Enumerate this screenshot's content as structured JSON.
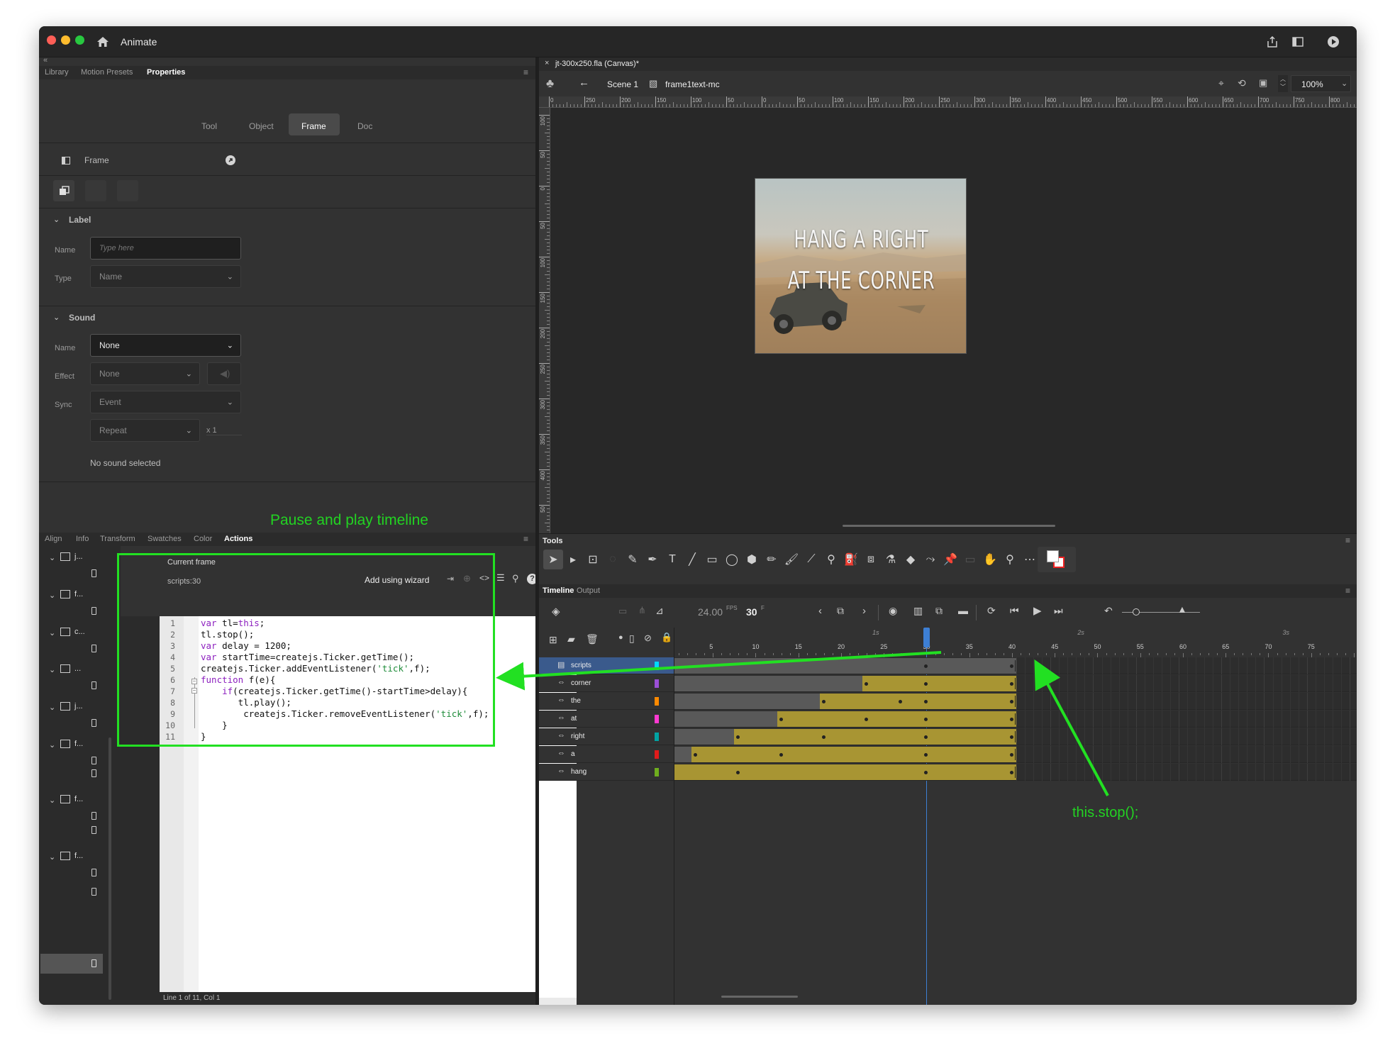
{
  "app": {
    "name": "Animate",
    "document_tab": "jt-300x250.fla (Canvas)*"
  },
  "colors": {
    "annotation_green": "#22e022",
    "tween_gold": "#a89533",
    "playhead_blue": "#3d7fd4",
    "selected_layer": "#3a5a8c"
  },
  "left_panel": {
    "collapse_glyph": "«",
    "tabs": [
      "Library",
      "Motion Presets",
      "Properties"
    ],
    "active_tab": "Properties",
    "prop_tabs": [
      "Tool",
      "Object",
      "Frame",
      "Doc"
    ],
    "active_prop_tab": "Frame",
    "frame_header": "Frame",
    "label_section": {
      "title": "Label",
      "name_label": "Name",
      "name_placeholder": "Type here",
      "type_label": "Type",
      "type_value": "Name"
    },
    "sound_section": {
      "title": "Sound",
      "name_label": "Name",
      "name_value": "None",
      "effect_label": "Effect",
      "effect_value": "None",
      "sync_label": "Sync",
      "sync_value": "Event",
      "repeat_value": "Repeat",
      "repeat_count": "x 1",
      "status": "No sound selected"
    }
  },
  "actions_panel": {
    "tabs": [
      "Align",
      "Info",
      "Transform",
      "Swatches",
      "Color",
      "Actions"
    ],
    "active_tab": "Actions",
    "current_frame_label": "Current frame",
    "script_location": "scripts:30",
    "wizard_button": "Add using wizard",
    "status_bar": "Line 1 of 11, Col 1",
    "tree_items": [
      "j...",
      "f...",
      "c...",
      "...",
      "j...",
      "f...",
      "f...",
      "f..."
    ],
    "code_lines": [
      {
        "n": "1",
        "parts": [
          [
            "kw",
            "var"
          ],
          [
            "t",
            " tl="
          ],
          [
            "kw",
            "this"
          ],
          [
            "t",
            ";"
          ]
        ]
      },
      {
        "n": "2",
        "parts": [
          [
            "t",
            "tl.stop();"
          ]
        ]
      },
      {
        "n": "3",
        "parts": [
          [
            "kw",
            "var"
          ],
          [
            "t",
            " delay = 1200;"
          ]
        ]
      },
      {
        "n": "4",
        "parts": [
          [
            "kw",
            "var"
          ],
          [
            "t",
            " startTime=createjs.Ticker.getTime();"
          ]
        ]
      },
      {
        "n": "5",
        "parts": [
          [
            "t",
            "createjs.Ticker.addEventListener("
          ],
          [
            "str",
            "'tick'"
          ],
          [
            "t",
            ",f);"
          ]
        ]
      },
      {
        "n": "6",
        "parts": [
          [
            "kw",
            "function"
          ],
          [
            "t",
            " f(e){"
          ]
        ]
      },
      {
        "n": "7",
        "parts": [
          [
            "t",
            "    "
          ],
          [
            "kw",
            "if"
          ],
          [
            "t",
            "(createjs.Ticker.getTime()-startTime>delay){"
          ]
        ]
      },
      {
        "n": "8",
        "parts": [
          [
            "t",
            "       tl.play();"
          ]
        ]
      },
      {
        "n": "9",
        "parts": [
          [
            "t",
            "        createjs.Ticker.removeEventListener("
          ],
          [
            "str",
            "'tick'"
          ],
          [
            "t",
            ",f);"
          ]
        ]
      },
      {
        "n": "10",
        "parts": [
          [
            "t",
            "    }"
          ]
        ]
      },
      {
        "n": "11",
        "parts": [
          [
            "t",
            "}"
          ]
        ]
      }
    ]
  },
  "stage": {
    "breadcrumb": [
      "Scene 1",
      "frame1text-mc"
    ],
    "zoom": "100%",
    "h_ruler": [
      "0",
      "250",
      "200",
      "150",
      "100",
      "50",
      "0",
      "50",
      "100",
      "150",
      "200",
      "250",
      "300",
      "350",
      "400",
      "450",
      "500",
      "550",
      "600",
      "650",
      "700",
      "750",
      "800"
    ],
    "v_ruler": [
      "100",
      "50",
      "0",
      "50",
      "100",
      "150",
      "200",
      "250",
      "300",
      "350",
      "400",
      "50"
    ],
    "artwork_line1": "HANG A RIGHT",
    "artwork_line2": "AT THE CORNER"
  },
  "tools_panel": {
    "title": "Tools"
  },
  "timeline": {
    "tabs": [
      "Timeline",
      "Output"
    ],
    "active_tab": "Timeline",
    "fps": "24.00",
    "fps_unit": "FPS",
    "current_frame": "30",
    "frame_unit": "F",
    "seconds_marks": [
      "1s",
      "2s",
      "3s"
    ],
    "frame_numbers": [
      "5",
      "10",
      "15",
      "20",
      "25",
      "30",
      "35",
      "40",
      "45",
      "50",
      "55",
      "60",
      "65",
      "70",
      "75"
    ],
    "playhead_frame": 30,
    "layers": [
      {
        "name": "scripts",
        "color": "#00d9ff",
        "selected": true,
        "start": 1,
        "end": 40,
        "tween_start": null,
        "key_frames": [
          30,
          40
        ]
      },
      {
        "name": "corner",
        "color": "#9b4fd6",
        "selected": false,
        "start": 1,
        "end": 40,
        "tween_start": 23,
        "key_frames": [
          23,
          30,
          40
        ]
      },
      {
        "name": "the",
        "color": "#ff8a00",
        "selected": false,
        "start": 1,
        "end": 40,
        "tween_start": 18,
        "key_frames": [
          18,
          27,
          30,
          40
        ]
      },
      {
        "name": "at",
        "color": "#ff3ad1",
        "selected": false,
        "start": 1,
        "end": 40,
        "tween_start": 13,
        "key_frames": [
          13,
          23,
          30,
          40
        ]
      },
      {
        "name": "right",
        "color": "#00a3a3",
        "selected": false,
        "start": 1,
        "end": 40,
        "tween_start": 8,
        "key_frames": [
          8,
          18,
          30,
          40
        ]
      },
      {
        "name": "a",
        "color": "#e01b1b",
        "selected": false,
        "start": 1,
        "end": 40,
        "tween_start": 3,
        "key_frames": [
          3,
          13,
          30,
          40
        ]
      },
      {
        "name": "hang",
        "color": "#6fae1e",
        "selected": false,
        "start": 1,
        "end": 40,
        "tween_start": 1,
        "key_frames": [
          8,
          30,
          40
        ]
      }
    ]
  },
  "annotations": {
    "pause_play": "Pause and play timeline",
    "stop": "this.stop();"
  }
}
